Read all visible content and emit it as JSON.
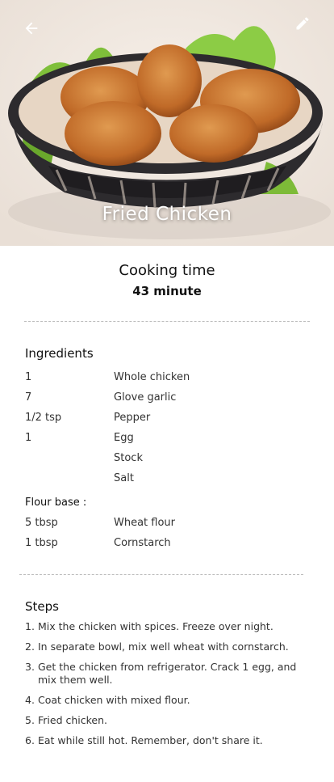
{
  "hero": {
    "title": "Fried Chicken",
    "image_icon": "fried-chicken-basket-photo"
  },
  "toolbar": {
    "back_icon": "arrow-left-icon",
    "edit_icon": "pencil-icon"
  },
  "cooking": {
    "label": "Cooking time",
    "value": "43 minute"
  },
  "ingredients": {
    "title": "Ingredients",
    "items": [
      {
        "qty": "1",
        "name": "Whole chicken"
      },
      {
        "qty": "7",
        "name": "Glove garlic"
      },
      {
        "qty": "1/2 tsp",
        "name": "Pepper"
      },
      {
        "qty": "1",
        "name": "Egg"
      },
      {
        "qty": "",
        "name": "Stock"
      },
      {
        "qty": "",
        "name": "Salt"
      }
    ],
    "flour_title": "Flour base :",
    "flour_items": [
      {
        "qty": "5 tbsp",
        "name": "Wheat flour"
      },
      {
        "qty": "1 tbsp",
        "name": "Cornstarch"
      }
    ]
  },
  "steps": {
    "title": "Steps",
    "items": [
      {
        "num": "1.",
        "text": "Mix the chicken with spices. Freeze over night."
      },
      {
        "num": "2.",
        "text": "In separate bowl, mix well wheat with cornstarch."
      },
      {
        "num": "3.",
        "text": "Get the chicken from refrigerator. Crack 1 egg, and mix them well."
      },
      {
        "num": "4.",
        "text": "Coat chicken with mixed flour."
      },
      {
        "num": "5.",
        "text": "Fried chicken."
      },
      {
        "num": "6.",
        "text": "Eat while still hot. Remember, don't share it."
      }
    ]
  }
}
